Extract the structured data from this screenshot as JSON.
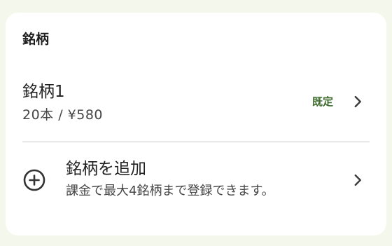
{
  "section": {
    "title": "銘柄"
  },
  "brands": [
    {
      "name": "銘柄1",
      "detail": "20本 / ¥580",
      "badge": "既定",
      "chevron_icon": "chevron-right-icon"
    }
  ],
  "add_brand": {
    "title": "銘柄を追加",
    "description": "課金で最大4銘柄まで登録できます。",
    "icon": "add-circle-icon",
    "chevron_icon": "chevron-right-icon"
  },
  "colors": {
    "background": "#f4f7ec",
    "card": "#ffffff",
    "badge_text": "#3d6b2d",
    "divider": "#c8c8c8"
  }
}
